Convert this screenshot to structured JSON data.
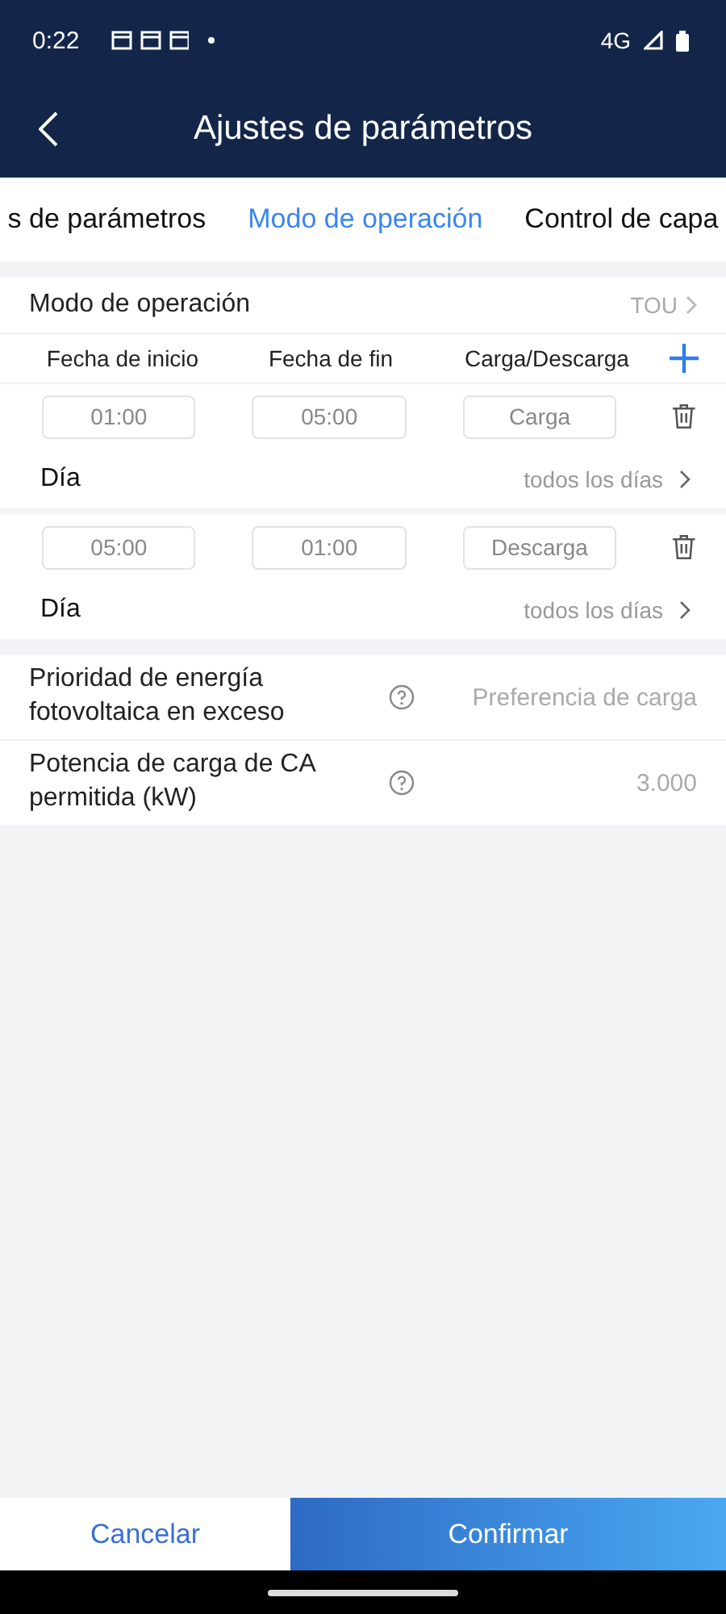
{
  "status_bar": {
    "time": "0:22",
    "network": "4G"
  },
  "header": {
    "title": "Ajustes de parámetros"
  },
  "tabs": [
    {
      "label": "s de parámetros",
      "selected": false
    },
    {
      "label": "Modo de operación",
      "selected": true
    },
    {
      "label": "Control de capa",
      "selected": false
    }
  ],
  "mode": {
    "label": "Modo de operación",
    "value": "TOU"
  },
  "schedule": {
    "columns": [
      "Fecha de inicio",
      "Fecha de fin",
      "Carga/Descarga"
    ],
    "entries": [
      {
        "start": "01:00",
        "end": "05:00",
        "action": "Carga",
        "day_label": "Día",
        "day_value": "todos los días"
      },
      {
        "start": "05:00",
        "end": "01:00",
        "action": "Descarga",
        "day_label": "Día",
        "day_value": "todos los días"
      }
    ]
  },
  "settings": [
    {
      "label": "Prioridad de energía fotovoltaica en exceso",
      "value": "Preferencia de carga"
    },
    {
      "label": "Potencia de carga de CA permitida (kW)",
      "value": "3.000"
    }
  ],
  "buttons": {
    "cancel": "Cancelar",
    "confirm": "Confirmar"
  }
}
